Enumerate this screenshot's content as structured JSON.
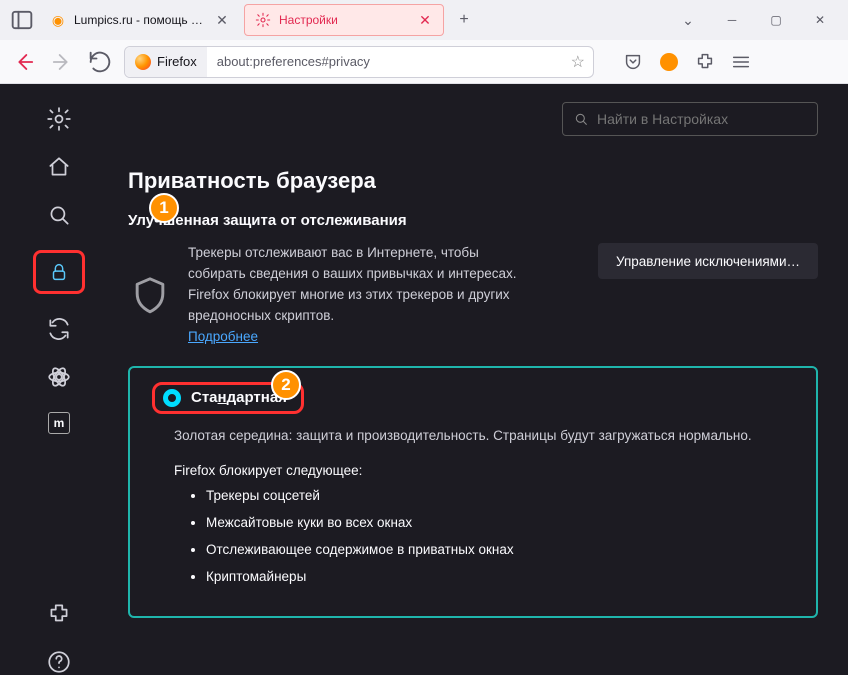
{
  "tabs": {
    "inactive": {
      "title": "Lumpics.ru - помощь с компь",
      "icon_color": "#ff9100"
    },
    "active": {
      "title": "Настройки",
      "icon": "gear"
    }
  },
  "urlbar": {
    "identity": "Firefox",
    "url": "about:preferences#privacy"
  },
  "search": {
    "placeholder": "Найти в Настройках"
  },
  "page": {
    "heading": "Приватность браузера",
    "subheading": "Улучшенная защита от отслеживания",
    "tracking_desc": "Трекеры отслеживают вас в Интернете, чтобы собирать сведения о ваших привычках и интересах. Firefox блокирует многие из этих трекеров и других вредоносных скриптов.",
    "learn_more": "Подробнее",
    "manage_exceptions": "Управление исключениями…"
  },
  "option": {
    "title_pre": "Ста",
    "title_ul": "н",
    "title_post": "дартная",
    "desc": "Золотая середина: защита и производительность. Страницы будут загружаться нормально.",
    "blocks_hdr": "Firefox блокирует следующее:",
    "items": [
      "Трекеры соцсетей",
      "Межсайтовые куки во всех окнах",
      "Отслеживающее содержимое в приватных окнах",
      "Криптомайнеры"
    ]
  },
  "callouts": {
    "one": "1",
    "two": "2"
  },
  "sidebar": {
    "m_label": "m"
  }
}
